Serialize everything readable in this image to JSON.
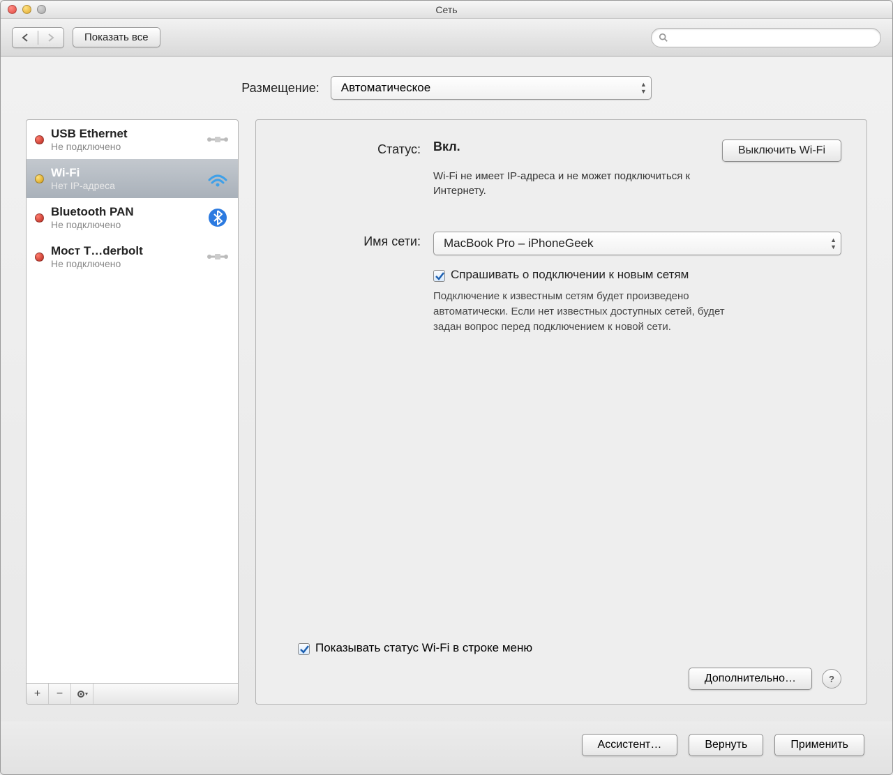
{
  "window_title": "Сеть",
  "toolbar": {
    "show_all_label": "Показать все",
    "search_placeholder": ""
  },
  "location": {
    "label": "Размещение:",
    "value": "Автоматическое"
  },
  "services": [
    {
      "name": "USB Ethernet",
      "status": "Не подключено",
      "dot": "red",
      "icon": "ethernet"
    },
    {
      "name": "Wi-Fi",
      "status": "Нет IP-адреса",
      "dot": "yellow",
      "icon": "wifi",
      "selected": true
    },
    {
      "name": "Bluetooth PAN",
      "status": "Не подключено",
      "dot": "red",
      "icon": "bluetooth"
    },
    {
      "name": "Мост T…derbolt",
      "status": "Не подключено",
      "dot": "red",
      "icon": "ethernet"
    }
  ],
  "detail": {
    "status_label": "Статус:",
    "status_value": "Вкл.",
    "wifi_toggle_label": "Выключить Wi-Fi",
    "status_desc": "Wi-Fi не имеет IP-адреса и не может подключиться к Интернету.",
    "network_name_label": "Имя сети:",
    "network_name_value": "MacBook Pro – iPhoneGeek",
    "ask_join_label": "Спрашивать о подключении к новым сетям",
    "ask_join_help": "Подключение к известным сетям будет произведено автоматически. Если нет известных доступных сетей, будет задан вопрос перед подключением к новой сети.",
    "show_menu_label": "Показывать статус Wi-Fi в строке меню",
    "advanced_label": "Дополнительно…"
  },
  "footer": {
    "assist_label": "Ассистент…",
    "revert_label": "Вернуть",
    "apply_label": "Применить"
  }
}
